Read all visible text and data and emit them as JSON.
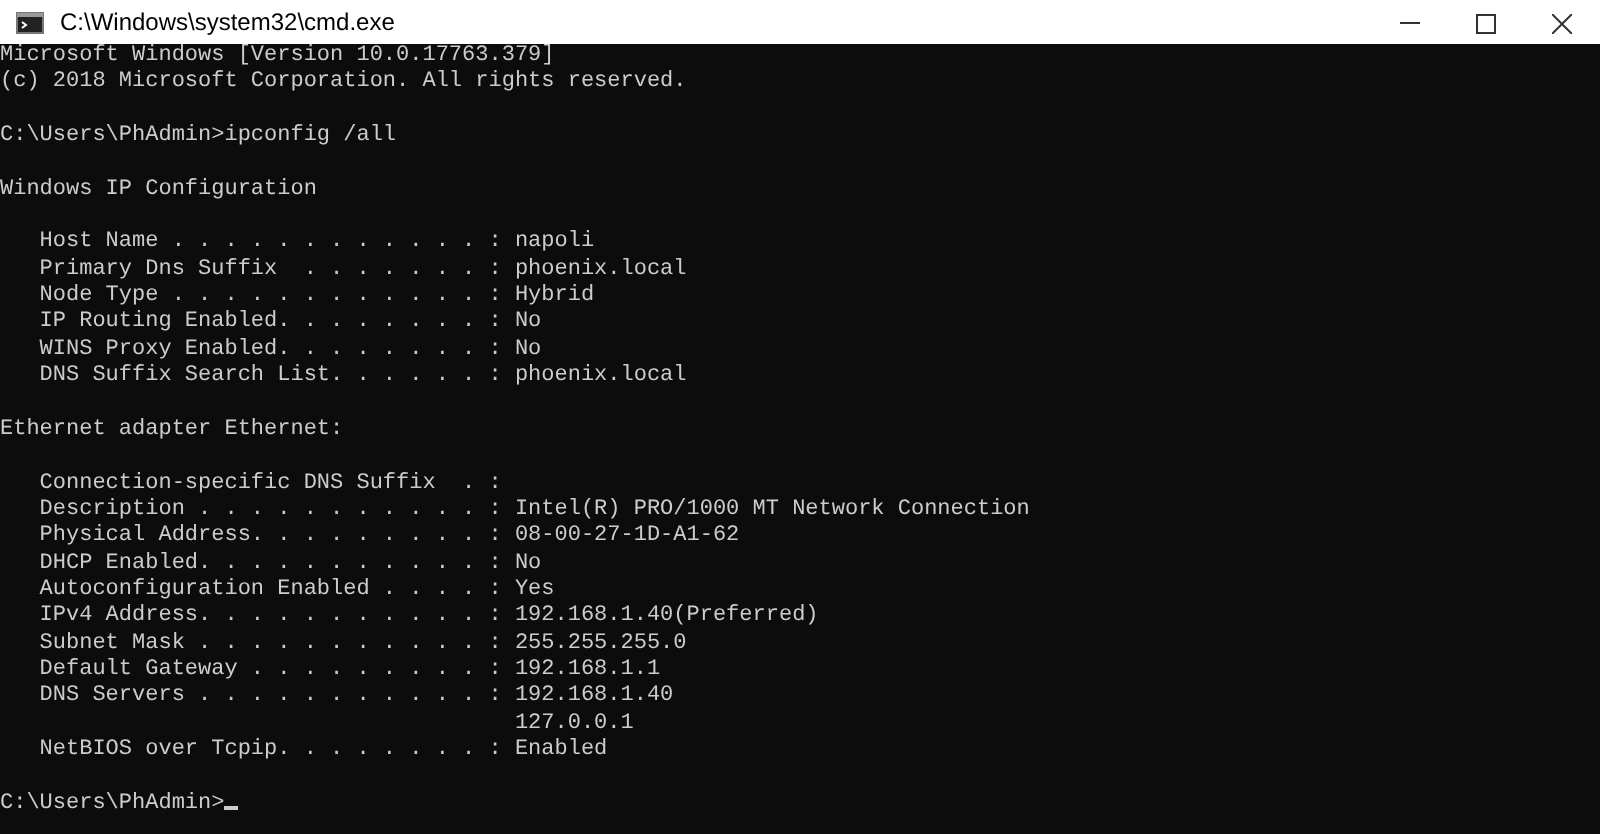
{
  "window": {
    "title": "C:\\Windows\\system32\\cmd.exe"
  },
  "console": {
    "blocks": [
      [
        "Microsoft Windows [Version 10.0.17763.379]",
        "(c) 2018 Microsoft Corporation. All rights reserved."
      ],
      [
        "C:\\Users\\PhAdmin>ipconfig /all"
      ],
      [
        "Windows IP Configuration"
      ],
      [
        "   Host Name . . . . . . . . . . . . : napoli",
        "   Primary Dns Suffix  . . . . . . . : phoenix.local",
        "   Node Type . . . . . . . . . . . . : Hybrid",
        "   IP Routing Enabled. . . . . . . . : No",
        "   WINS Proxy Enabled. . . . . . . . : No",
        "   DNS Suffix Search List. . . . . . : phoenix.local"
      ],
      [
        "Ethernet adapter Ethernet:"
      ],
      [
        "   Connection-specific DNS Suffix  . :",
        "   Description . . . . . . . . . . . : Intel(R) PRO/1000 MT Network Connection",
        "   Physical Address. . . . . . . . . : 08-00-27-1D-A1-62",
        "   DHCP Enabled. . . . . . . . . . . : No",
        "   Autoconfiguration Enabled . . . . : Yes",
        "   IPv4 Address. . . . . . . . . . . : 192.168.1.40(Preferred)",
        "   Subnet Mask . . . . . . . . . . . : 255.255.255.0",
        "   Default Gateway . . . . . . . . . : 192.168.1.1",
        "   DNS Servers . . . . . . . . . . . : 192.168.1.40",
        "                                       127.0.0.1",
        "   NetBIOS over Tcpip. . . . . . . . : Enabled"
      ],
      [
        "C:\\Users\\PhAdmin>"
      ]
    ],
    "cursor": true
  }
}
